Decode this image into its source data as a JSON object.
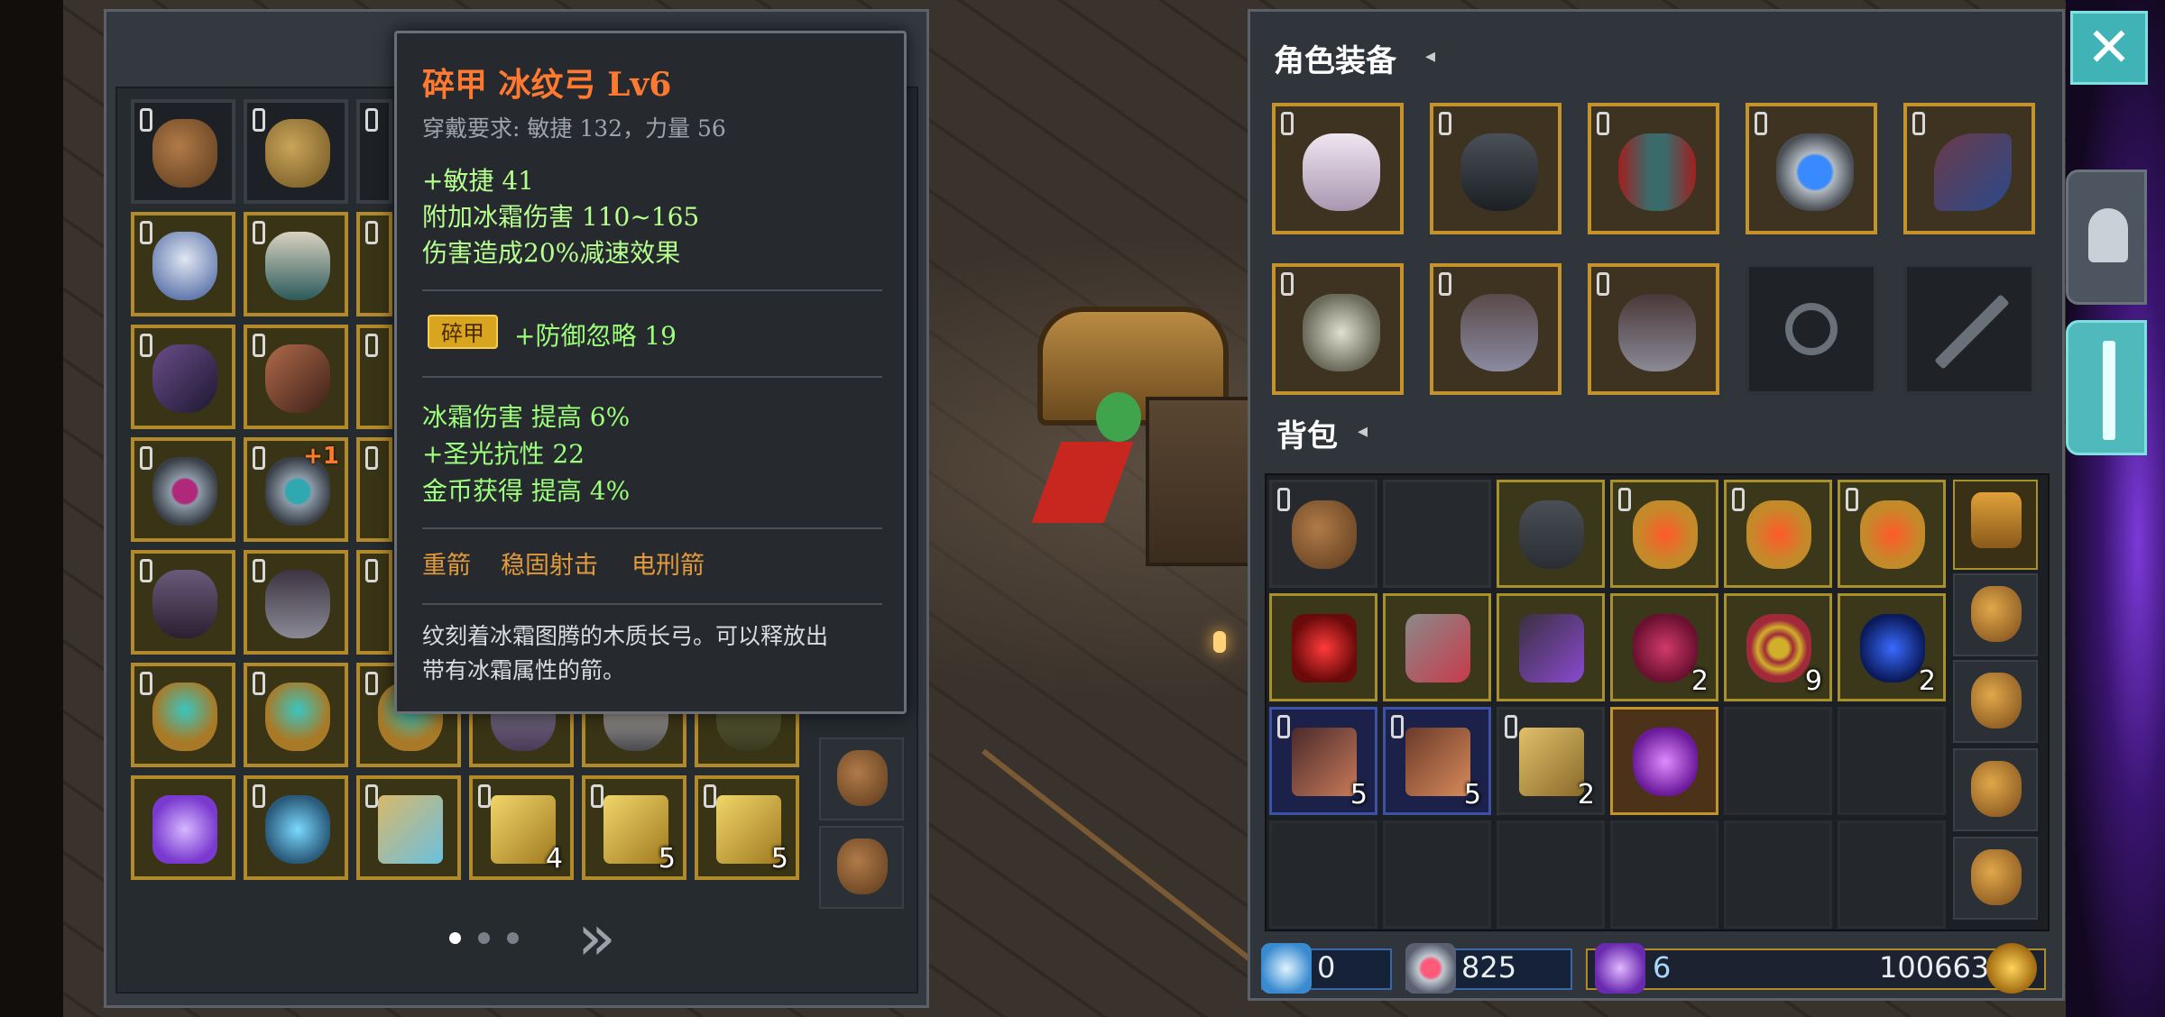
{
  "tooltip": {
    "title": "碎甲  冰纹弓 Lv6",
    "requirement": "穿戴要求:   敏捷 132，力量 56",
    "base_stats": [
      "+敏捷 41",
      "附加冰霜伤害 110~165",
      "伤害造成20%减速效果"
    ],
    "badge": "碎甲",
    "badge_stat": "+防御忽略 19",
    "extra_stats": [
      "冰霜伤害 提高 6%",
      "+圣光抗性 22",
      "金币获得 提高 4%"
    ],
    "skills": [
      "重箭",
      "稳固射击",
      "电刑箭"
    ],
    "description_lines": [
      "纹刻着冰霜图腾的木质长弓。可以释放出",
      "带有冰霜属性的箭。"
    ]
  },
  "inventory": {
    "upgrade_badge": "+1",
    "counts": [
      "4",
      "5",
      "5"
    ]
  },
  "equipment": {
    "title": "角色装备",
    "arrow": "◂"
  },
  "backpack": {
    "title": "背包",
    "arrow": "◂",
    "counts": [
      "2",
      "9",
      "2",
      "5",
      "5",
      "2"
    ]
  },
  "currency": {
    "shard": "0",
    "crystal_heart": "825",
    "gem": "6",
    "gold": "100663"
  },
  "buttons": {
    "close": "✕",
    "next_page": "»"
  },
  "colors": {
    "item_gold_border": "#b38a2a",
    "title_orange": "#ff7a30",
    "stat_green": "#9cff7a",
    "skill_orange": "#e39a3a",
    "accent_teal": "#3fb3b5"
  }
}
